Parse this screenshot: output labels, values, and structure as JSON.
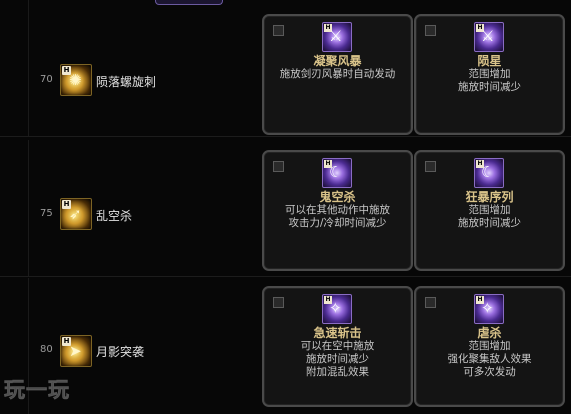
{
  "rows": [
    {
      "level": "70",
      "skill_name": "陨落螺旋刺",
      "cards": [
        {
          "title": "凝聚风暴",
          "lines": [
            "施放剑刃风暴时自动发动"
          ]
        },
        {
          "title": "陨星",
          "lines": [
            "范围增加",
            "施放时间减少"
          ]
        }
      ]
    },
    {
      "level": "75",
      "skill_name": "乱空杀",
      "cards": [
        {
          "title": "鬼空杀",
          "lines": [
            "可以在其他动作中施放",
            "攻击力/冷却时间减少"
          ]
        },
        {
          "title": "狂暴序列",
          "lines": [
            "范围增加",
            "施放时间减少"
          ]
        }
      ]
    },
    {
      "level": "80",
      "skill_name": "月影突袭",
      "cards": [
        {
          "title": "急速斩击",
          "lines": [
            "可以在空中施放",
            "施放时间减少",
            "附加混乱效果"
          ]
        },
        {
          "title": "虐杀",
          "lines": [
            "范围增加",
            "强化聚集敌人效果",
            "可多次发动"
          ]
        }
      ]
    }
  ],
  "badge_label": "H",
  "watermark": "玩一玩",
  "colors": {
    "card_title": "#d9c38a",
    "rune_purple": "#9a6ee0",
    "skill_gold": "#d09a2c"
  },
  "icons": {
    "skill": "golden-skill-icon",
    "rune": "purple-rune-icon"
  }
}
